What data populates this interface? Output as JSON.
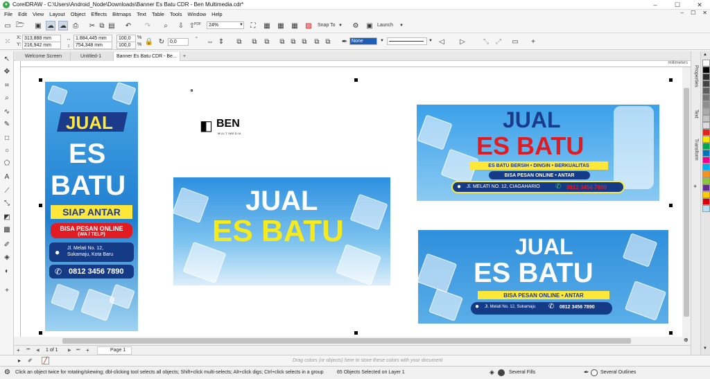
{
  "window": {
    "title": "CorelDRAW - C:\\Users\\Android_Node\\Downloads\\Banner Es Batu CDR - Ben Multimedia.cdr*",
    "minimize": "–",
    "maximize": "☐",
    "close": "✕"
  },
  "menu": [
    "File",
    "Edit",
    "View",
    "Layout",
    "Object",
    "Effects",
    "Bitmaps",
    "Text",
    "Table",
    "Tools",
    "Window",
    "Help"
  ],
  "toolbar": {
    "zoom": "24%",
    "snap_to": "Snap To",
    "launch": "Launch"
  },
  "property_bar": {
    "x_label": "X:",
    "x_value": "313,888 mm",
    "y_label": "Y:",
    "y_value": "216,942 mm",
    "w_value": "1.884,445 mm",
    "h_value": "754,348 mm",
    "scale_x": "100,0",
    "scale_y": "100,0",
    "percent": "%",
    "rotation": "0,0",
    "degree": "°",
    "outline_style": "None"
  },
  "tabs": [
    {
      "label": "Welcome Screen"
    },
    {
      "label": "Untitled-1"
    },
    {
      "label": "Banner Es Batu CDR - Be..."
    }
  ],
  "tab_add": "+",
  "ruler_unit": "millimeters",
  "dockers": [
    "Properties",
    "Text",
    "Transform"
  ],
  "palette_colors": [
    "#ffffff",
    "#000000",
    "#2b2b2b",
    "#444444",
    "#5e5e5e",
    "#777777",
    "#909090",
    "#aaaaaa",
    "#c3c3c3",
    "#dcdcdc",
    "#e5231b",
    "#f7e600",
    "#00a651",
    "#0072bc",
    "#ec008c",
    "#00aeef",
    "#f7941d",
    "#8dc63f",
    "#662d91",
    "#ffcb05",
    "#d7000f",
    "#b8e0f7"
  ],
  "logo": {
    "name": "BEN",
    "sub": "MULTIMEDIA"
  },
  "vertical_banner": {
    "title1": "JUAL",
    "title2": "ES",
    "title3": "BATU",
    "badge": "SIAP ANTAR",
    "order": "BISA PESAN ONLINE",
    "order_sub": "(WA / TELP)",
    "address": "Jl. Melati No. 12,",
    "address2": "Sukamaju, Kota Baru",
    "phone": "0812 3456 7890"
  },
  "center_banner": {
    "title1": "JUAL",
    "title2": "ES BATU"
  },
  "top_right_banner": {
    "title1": "JUAL",
    "title2": "ES BATU",
    "tagline": "ES BATU BERSIH • DINGIN • BERKUALITAS",
    "order": "BISA PESAN ONLINE • ANTAR",
    "address": "Jl. MELATI NO. 12, CIAGAHARIO",
    "phone": "0812 3456 7890"
  },
  "bottom_right_banner": {
    "title1": "JUAL",
    "title2": "ES BATU",
    "order": "BISA PESAN ONLINE  •  ANTAR",
    "address": "Jl. Melati No. 12, Sukamaju",
    "phone": "0812 3456 7890"
  },
  "page_nav": {
    "first": "⏮",
    "prev": "◀",
    "count": "1 of 1",
    "next": "▶",
    "last": "⏭",
    "page": "Page 1",
    "add": "+"
  },
  "drag_hint": "Drag colors (or objects) here to store these colors with your document",
  "status": {
    "hint": "Click an object twice for rotating/skewing; dbl-clicking tool selects all objects; Shift+click multi-selects; Alt+click digs; Ctrl+click selects in a group",
    "selection": "65 Objects Selected on Layer 1",
    "fills": "Several Fills",
    "outlines": "Several Outlines"
  }
}
